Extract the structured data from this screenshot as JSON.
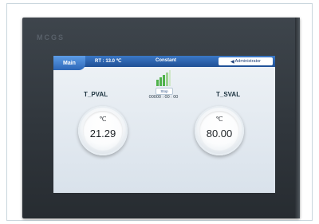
{
  "device": {
    "brand": "MCGS"
  },
  "header": {
    "tab_main": "Main",
    "rt_text": "RT :  13.0  ℃",
    "mode": "Constant",
    "user": "Administrator"
  },
  "status": {
    "state": "Stop",
    "timer": "00000 : 00 : 00"
  },
  "pv": {
    "label": "T_PVAL",
    "unit": "℃",
    "value": "21.29"
  },
  "sv": {
    "label": "T_SVAL",
    "unit": "℃",
    "value": "80.00"
  },
  "colors": {
    "header_blue": "#2b5fa8",
    "signal_green": "#4fb24a",
    "bezel": "#363c42"
  },
  "icons": {
    "status": "signal-bars-icon",
    "user_arrow": "arrow-left-icon"
  }
}
